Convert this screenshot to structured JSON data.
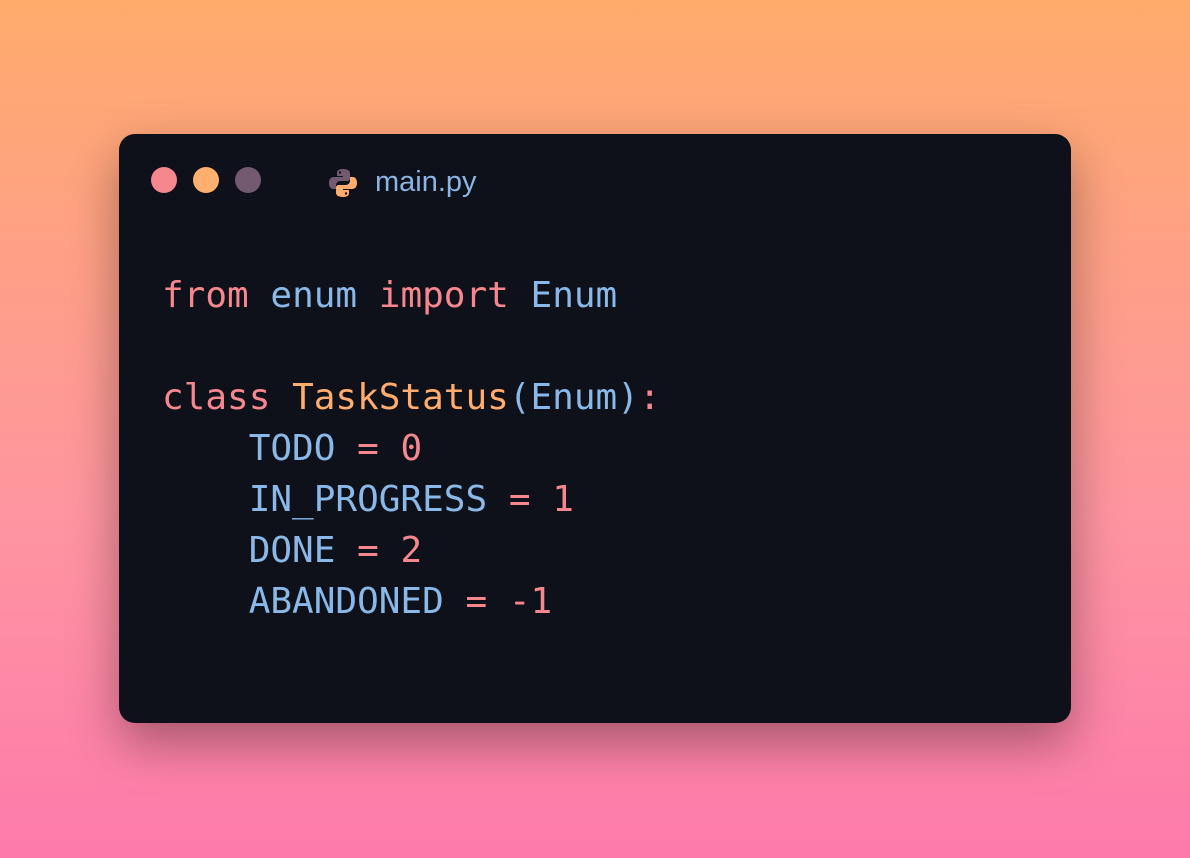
{
  "window": {
    "filename": "main.py",
    "file_icon": "python-icon",
    "colors": {
      "keyword": "#f7878f",
      "identifier": "#8ab8e8",
      "class_name": "#ffac6e",
      "background": "#0e1119"
    }
  },
  "code": {
    "line1": {
      "kw1": "from",
      "mod": "enum",
      "kw2": "import",
      "name": "Enum"
    },
    "line3": {
      "kw": "class",
      "cls": "TaskStatus",
      "po": "(",
      "base": "Enum",
      "pc": ")",
      "colon": ":"
    },
    "members": [
      {
        "name": "TODO",
        "op": "=",
        "value": "0"
      },
      {
        "name": "IN_PROGRESS",
        "op": "=",
        "value": "1"
      },
      {
        "name": "DONE",
        "op": "=",
        "value": "2"
      },
      {
        "name": "ABANDONED",
        "op": "=",
        "value": "-1"
      }
    ]
  }
}
